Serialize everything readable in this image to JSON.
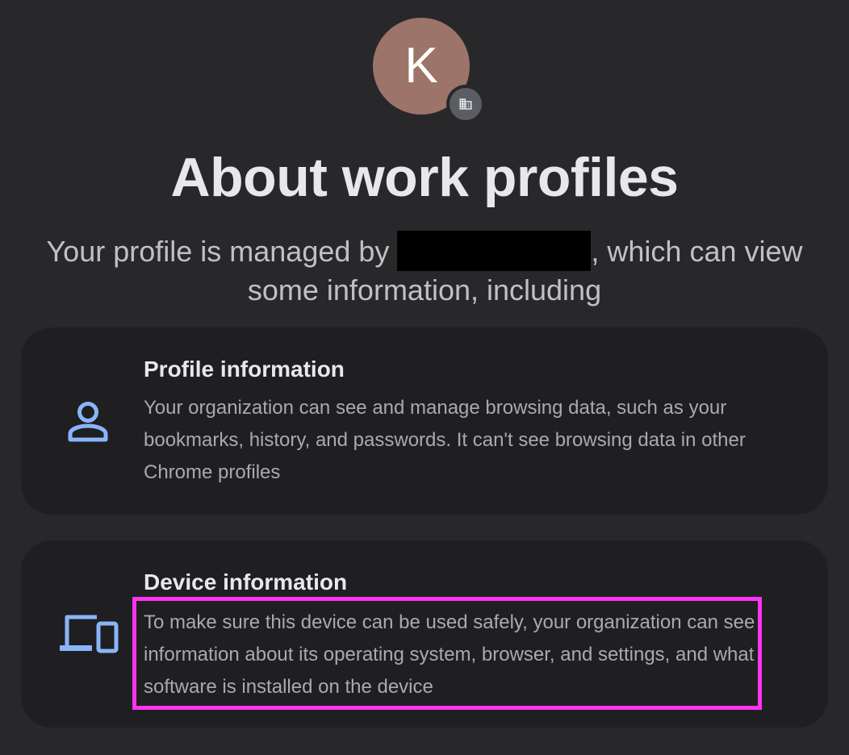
{
  "avatar": {
    "initial": "K",
    "color": "#9c7469"
  },
  "badge": {
    "icon": "building-icon"
  },
  "title": "About work profiles",
  "subtitle": {
    "before": "Your profile is managed by ",
    "after": ", which can view some information, including"
  },
  "cards": [
    {
      "icon": "person-icon",
      "title": "Profile information",
      "description": "Your organization can see and manage browsing data, such as your bookmarks, history, and passwords. It can't see browsing data in other Chrome profiles"
    },
    {
      "icon": "devices-icon",
      "title": "Device information",
      "description": "To make sure this device can be used safely, your organization can see information about its operating system, browser, and settings, and what software is installed on the device"
    }
  ],
  "colors": {
    "background": "#28282b",
    "card": "#1f1f21",
    "icon_accent": "#8ab4f8",
    "highlight": "#ff33f0"
  }
}
